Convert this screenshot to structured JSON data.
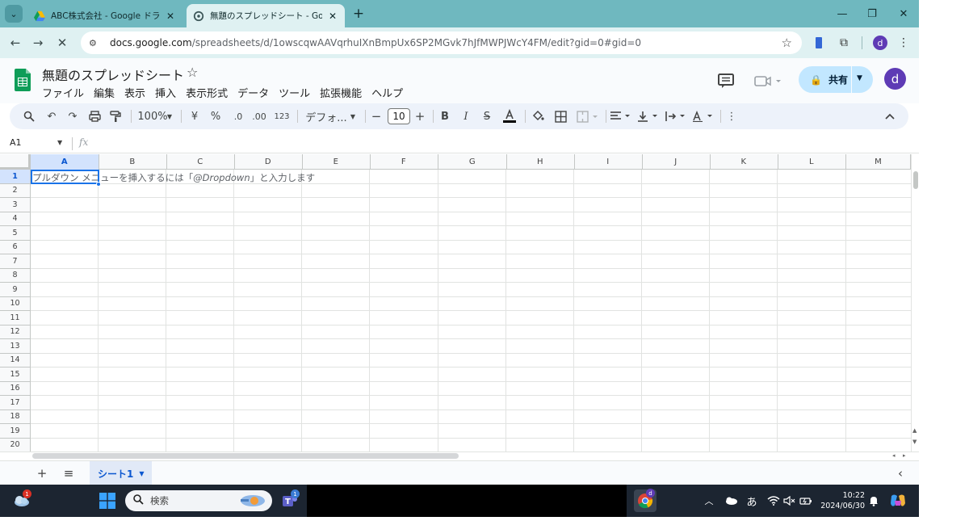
{
  "browser": {
    "tabs": [
      {
        "title": "ABC株式会社 - Google ドライブ",
        "active": false
      },
      {
        "title": "無題のスプレッドシート - Google ス",
        "active": true
      }
    ],
    "new_tab": "+",
    "url_host": "docs.google.com",
    "url_path": "/spreadsheets/d/1owscqwAAVqrhuIXnBmpUx6SP2MGvk7hJfMWPJWcY4FM/edit?gid=0#gid=0",
    "profile_initial": "d"
  },
  "app": {
    "doc_title": "無題のスプレッドシート",
    "menus": [
      "ファイル",
      "編集",
      "表示",
      "挿入",
      "表示形式",
      "データ",
      "ツール",
      "拡張機能",
      "ヘルプ"
    ],
    "share_label": "共有",
    "user_initial": "d"
  },
  "toolbar": {
    "zoom": "100%",
    "currency": "¥",
    "percent": "%",
    "dec_decrease": ".0",
    "dec_increase": ".00",
    "number_format": "123",
    "font_name": "デフォ...",
    "font_size": "10"
  },
  "formula_bar": {
    "cell_ref": "A1",
    "fx": "fx"
  },
  "grid": {
    "columns": [
      "A",
      "B",
      "C",
      "D",
      "E",
      "F",
      "G",
      "H",
      "I",
      "J",
      "K",
      "L",
      "M"
    ],
    "rows": [
      "1",
      "2",
      "3",
      "4",
      "5",
      "6",
      "7",
      "8",
      "9",
      "10",
      "11",
      "12",
      "13",
      "14",
      "15",
      "16",
      "17",
      "18",
      "19",
      "20"
    ],
    "selected_cell": "A1",
    "a1_hint_before": "プルダウン メニューを挿入するには「",
    "a1_hint_italic": "@Dropdown",
    "a1_hint_after": "」と入力します"
  },
  "sheets": {
    "add": "+",
    "list": "≡",
    "active_sheet": "シート1"
  },
  "taskbar": {
    "search_label": "検索",
    "ime": "あ",
    "time": "10:22",
    "date": "2024/06/30",
    "weather_badge": "1",
    "teams_badge": "1",
    "chrome_badge": "d"
  }
}
